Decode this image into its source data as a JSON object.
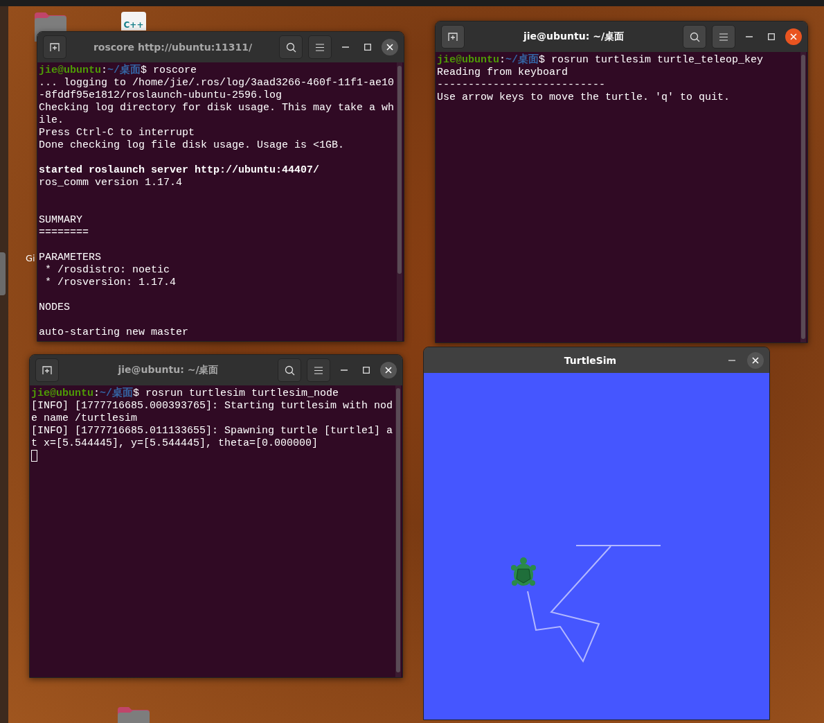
{
  "desktop": {
    "icons": [
      {
        "kind": "folder"
      },
      {
        "kind": "code-file",
        "badge": "C++"
      },
      {
        "kind": "folder"
      }
    ],
    "label_fragment": "Gi"
  },
  "terminals": [
    {
      "title": "roscore http://ubuntu:11311/",
      "focused": false,
      "lines": [
        {
          "kind": "prompt",
          "user": "jie@ubuntu",
          "colon": ":",
          "path": "~/桌面",
          "rest": "$ roscore"
        },
        {
          "kind": "text",
          "text": "... logging to /home/jie/.ros/log/3aad3266-460f-11f1-ae10"
        },
        {
          "kind": "text",
          "text": "-8fddf95e1812/roslaunch-ubuntu-2596.log"
        },
        {
          "kind": "text",
          "text": "Checking log directory for disk usage. This may take a wh"
        },
        {
          "kind": "text",
          "text": "ile."
        },
        {
          "kind": "text",
          "text": "Press Ctrl-C to interrupt"
        },
        {
          "kind": "text",
          "text": "Done checking log file disk usage. Usage is <1GB."
        },
        {
          "kind": "blank"
        },
        {
          "kind": "bold",
          "text": "started roslaunch server http://ubuntu:44407/"
        },
        {
          "kind": "text",
          "text": "ros_comm version 1.17.4"
        },
        {
          "kind": "blank"
        },
        {
          "kind": "blank"
        },
        {
          "kind": "text",
          "text": "SUMMARY"
        },
        {
          "kind": "text",
          "text": "========"
        },
        {
          "kind": "blank"
        },
        {
          "kind": "text",
          "text": "PARAMETERS"
        },
        {
          "kind": "text",
          "text": " * /rosdistro: noetic"
        },
        {
          "kind": "text",
          "text": " * /rosversion: 1.17.4"
        },
        {
          "kind": "blank"
        },
        {
          "kind": "text",
          "text": "NODES"
        },
        {
          "kind": "blank"
        },
        {
          "kind": "text",
          "text": "auto-starting new master"
        }
      ]
    },
    {
      "title": "jie@ubuntu: ~/桌面",
      "focused": true,
      "lines": [
        {
          "kind": "prompt",
          "user": "jie@ubuntu",
          "colon": ":",
          "path": "~/桌面",
          "rest": "$ rosrun turtlesim turtle_teleop_key"
        },
        {
          "kind": "text",
          "text": "Reading from keyboard"
        },
        {
          "kind": "text",
          "text": "---------------------------"
        },
        {
          "kind": "text",
          "text": "Use arrow keys to move the turtle. 'q' to quit."
        }
      ]
    },
    {
      "title": "jie@ubuntu: ~/桌面",
      "focused": false,
      "lines": [
        {
          "kind": "prompt",
          "user": "jie@ubuntu",
          "colon": ":",
          "path": "~/桌面",
          "rest": "$ rosrun turtlesim turtlesim_node"
        },
        {
          "kind": "text",
          "text": "[INFO] [1777716685.000393765]: Starting turtlesim with nod"
        },
        {
          "kind": "text",
          "text": "e name /turtlesim"
        },
        {
          "kind": "text",
          "text": "[INFO] [1777716685.011133655]: Spawning turtle [turtle1] a"
        },
        {
          "kind": "text",
          "text": "t x=[5.544445], y=[5.544445], theta=[0.000000]"
        },
        {
          "kind": "cursor"
        }
      ]
    }
  ],
  "turtlesim": {
    "title": "TurtleSim",
    "focused": false
  }
}
